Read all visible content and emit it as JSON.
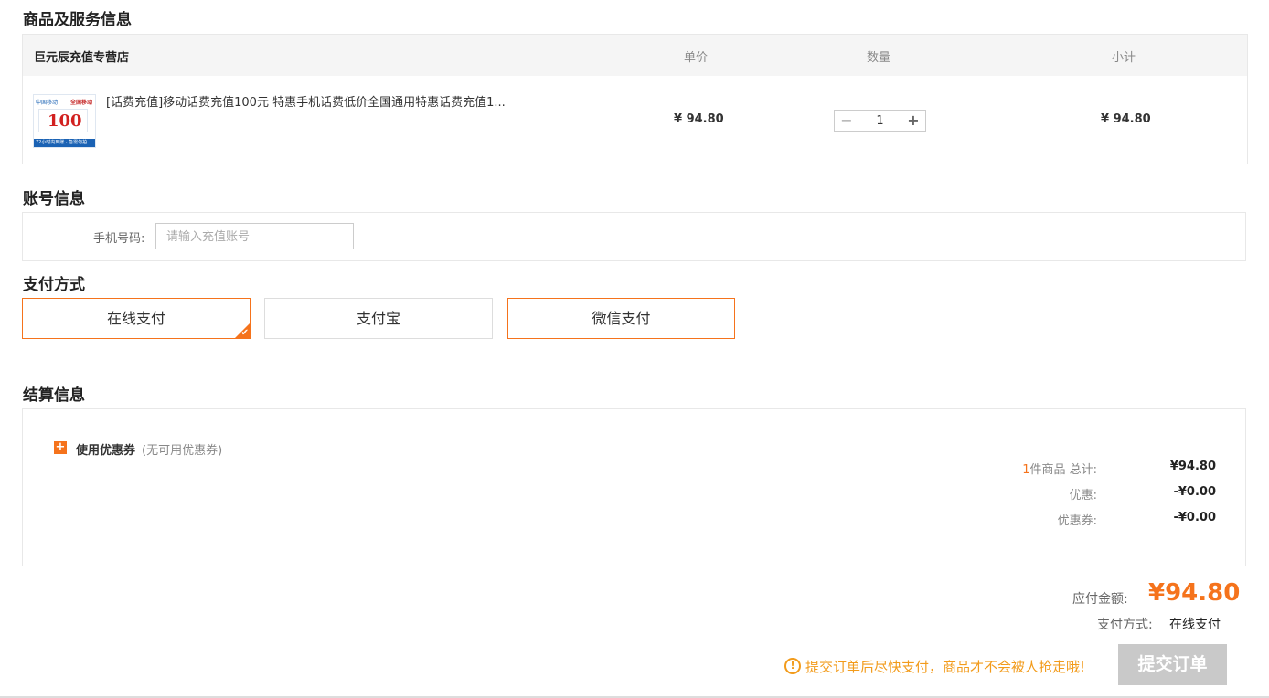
{
  "sections": {
    "products": "商品及服务信息",
    "account": "账号信息",
    "payment": "支付方式",
    "settlement": "结算信息"
  },
  "table": {
    "shop_name": "巨元辰充值专营店",
    "col_unit_price": "单价",
    "col_quantity": "数量",
    "col_subtotal": "小计"
  },
  "product": {
    "thumb_brand": "中国移动",
    "thumb_brand2": "全国移动",
    "thumb_value": "100",
    "thumb_strip": "72小时内到账 · 急需勿拍",
    "name": "[话费充值]移动话费充值100元 特惠手机话费低价全国通用特惠话费充值1...",
    "unit_price": "¥ 94.80",
    "qty_minus": "−",
    "quantity": "1",
    "qty_plus": "+",
    "subtotal": "¥ 94.80"
  },
  "account": {
    "label": "手机号码:",
    "placeholder": "请输入充值账号"
  },
  "payment_options": [
    {
      "label": "在线支付",
      "selected": true
    },
    {
      "label": "支付宝",
      "selected": false
    },
    {
      "label": "微信支付",
      "selected": false
    }
  ],
  "payment_check_mark": "✔",
  "coupon": {
    "toggle": "+",
    "label": "使用优惠券",
    "note": "(无可用优惠券)"
  },
  "summary": {
    "count": "1",
    "count_suffix": "件商品  总计:",
    "total": "¥94.80",
    "discount_label": "优惠:",
    "discount": "-¥0.00",
    "coupon_label": "优惠券:",
    "coupon": "-¥0.00"
  },
  "footer": {
    "amount_label": "应付金额:",
    "amount": "¥94.80",
    "method_label": "支付方式:",
    "method_value": "在线支付",
    "warn_icon": "!",
    "warning": "提交订单后尽快支付，商品才不会被人抢走哦!",
    "submit": "提交订单"
  },
  "colors": {
    "accent": "#f5731c",
    "warning": "#f29b1b",
    "submit_disabled": "#c9c9c9"
  }
}
